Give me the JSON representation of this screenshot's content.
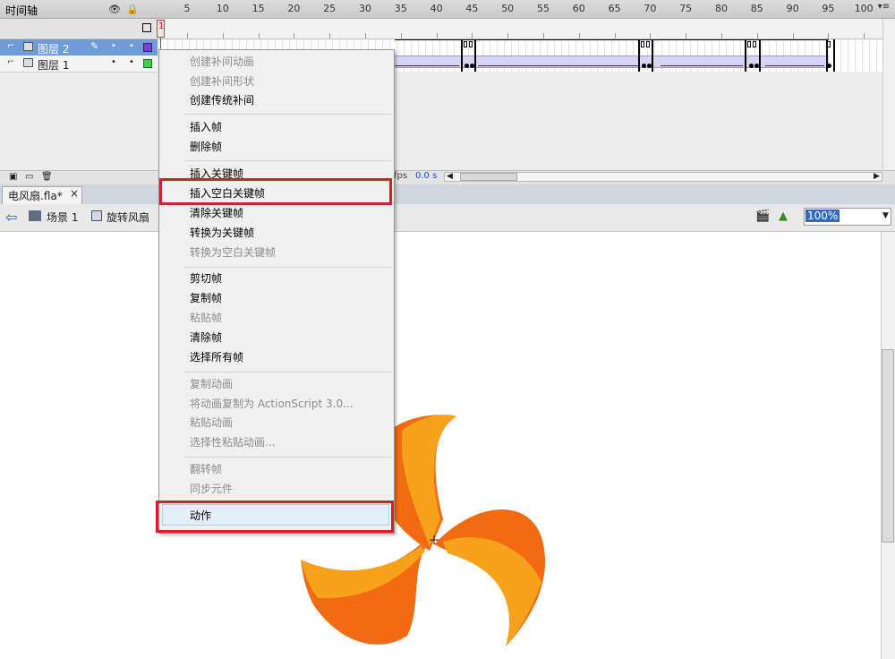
{
  "timeline_panel": {
    "title": "时间轴",
    "frame_numbers": [
      "1",
      "5",
      "10",
      "15",
      "20",
      "25",
      "30",
      "35",
      "40",
      "45",
      "50",
      "55",
      "60",
      "65",
      "70",
      "75",
      "80",
      "85",
      "90",
      "95",
      "100"
    ],
    "layers": [
      {
        "name": "图层 2",
        "selected": true,
        "color": "#7b3fd1"
      },
      {
        "name": "图层 1",
        "selected": false,
        "color": "#3cd14a"
      }
    ],
    "fps_label": "fps",
    "time_value": "0.0 s"
  },
  "document": {
    "tab_label": "电风扇.fla*",
    "close_glyph": "×",
    "scene_label": "场景 1",
    "symbol_label": "旋转风扇",
    "zoom": "100%"
  },
  "context_menu": {
    "items": [
      {
        "label": "创建补间动画",
        "enabled": false
      },
      {
        "label": "创建补间形状",
        "enabled": false
      },
      {
        "label": "创建传统补间",
        "enabled": true
      },
      {
        "label": "插入帧",
        "enabled": true
      },
      {
        "label": "删除帧",
        "enabled": true
      },
      {
        "label": "插入关键帧",
        "enabled": true
      },
      {
        "label": "插入空白关键帧",
        "enabled": true,
        "highlighted": true
      },
      {
        "label": "清除关键帧",
        "enabled": true
      },
      {
        "label": "转换为关键帧",
        "enabled": true
      },
      {
        "label": "转换为空白关键帧",
        "enabled": false
      },
      {
        "label": "剪切帧",
        "enabled": true
      },
      {
        "label": "复制帧",
        "enabled": true
      },
      {
        "label": "粘贴帧",
        "enabled": false
      },
      {
        "label": "清除帧",
        "enabled": true
      },
      {
        "label": "选择所有帧",
        "enabled": true
      },
      {
        "label": "复制动画",
        "enabled": false
      },
      {
        "label": "将动画复制为 ActionScript 3.0...",
        "enabled": false
      },
      {
        "label": "粘贴动画",
        "enabled": false
      },
      {
        "label": "选择性粘贴动画...",
        "enabled": false
      },
      {
        "label": "翻转帧",
        "enabled": false
      },
      {
        "label": "同步元件",
        "enabled": false
      },
      {
        "label": "动作",
        "enabled": true,
        "highlighted": true
      }
    ]
  },
  "colors": {
    "highlight_box": "#d3202a",
    "fan_orange": "#f26a12",
    "fan_yellow": "#f8a11a",
    "selected_layer": "#6f9bd8"
  }
}
